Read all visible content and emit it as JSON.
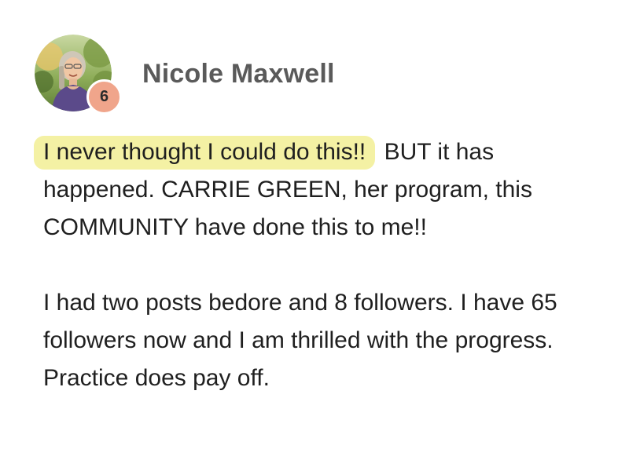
{
  "author": {
    "name": "Nicole Maxwell",
    "level": "6"
  },
  "post": {
    "highlight_text": "I never thought I could do this!!",
    "paragraph1_rest": "BUT it has happened. CARRIE GREEN, her program, this COMMUNITY have done this to me!!",
    "paragraph2": "I had two posts bedore and 8 followers. I have 65 followers now and I am thrilled with the progress. Practice does pay off.",
    "highlight_color": "#f4f1a4"
  },
  "colors": {
    "badge": "#f0a58b",
    "name": "#5a5a5a",
    "text": "#1f1f1f"
  }
}
